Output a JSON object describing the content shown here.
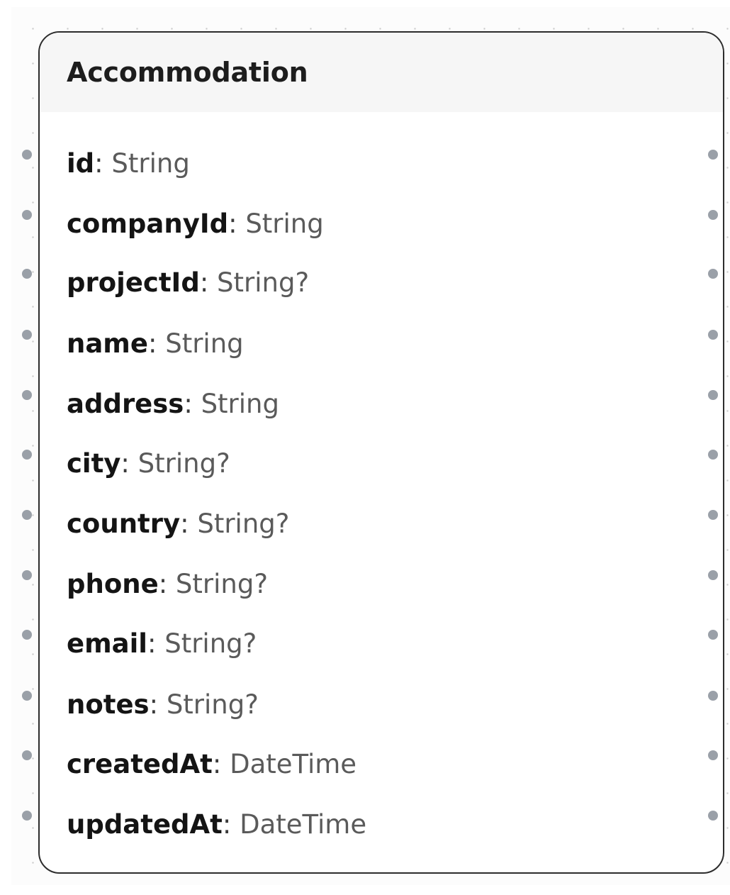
{
  "model": {
    "title": "Accommodation",
    "fields": [
      {
        "name": "id",
        "separator": ": ",
        "type": "String"
      },
      {
        "name": "companyId",
        "separator": ": ",
        "type": "String"
      },
      {
        "name": "projectId",
        "separator": ": ",
        "type": "String?"
      },
      {
        "name": "name",
        "separator": ": ",
        "type": "String"
      },
      {
        "name": "address",
        "separator": ": ",
        "type": "String"
      },
      {
        "name": "city",
        "separator": ": ",
        "type": "String?"
      },
      {
        "name": "country",
        "separator": ": ",
        "type": "String?"
      },
      {
        "name": "phone",
        "separator": ": ",
        "type": "String?"
      },
      {
        "name": "email",
        "separator": ": ",
        "type": "String?"
      },
      {
        "name": "notes",
        "separator": ": ",
        "type": "String?"
      },
      {
        "name": "createdAt",
        "separator": ": ",
        "type": "DateTime"
      },
      {
        "name": "updatedAt",
        "separator": ": ",
        "type": "DateTime"
      }
    ]
  },
  "colors": {
    "border": "#2c2c2c",
    "header_background": "#f6f6f6",
    "handle": "#9aa0a8",
    "field_name": "#141414",
    "field_type": "#5a5a5a"
  }
}
